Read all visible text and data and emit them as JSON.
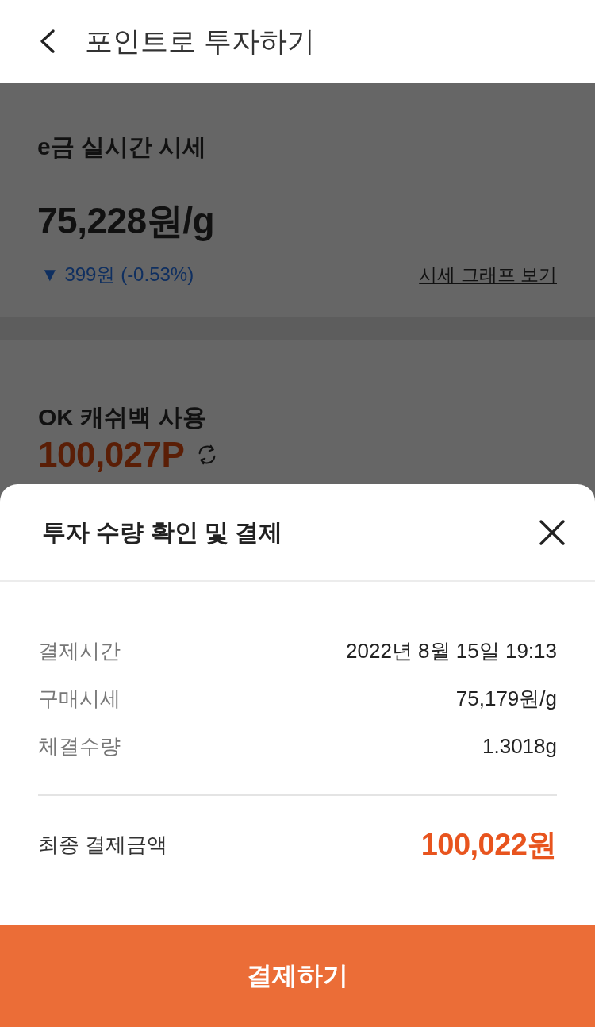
{
  "header": {
    "title": "포인트로 투자하기"
  },
  "price_card": {
    "title": "e금 실시간 시세",
    "price": "75,228원/g",
    "change": "▼ 399원 (-0.53%)",
    "graph_link": "시세 그래프 보기"
  },
  "points_card": {
    "title": "OK 캐쉬백 사용",
    "points": "100,027P"
  },
  "sheet": {
    "title": "투자 수량 확인 및 결제",
    "details": [
      {
        "label": "결제시간",
        "value": "2022년 8월 15일 19:13"
      },
      {
        "label": "구매시세",
        "value": "75,179원/g"
      },
      {
        "label": "체결수량",
        "value": "1.3018g"
      }
    ],
    "total": {
      "label": "최종 결제금액",
      "value": "100,022원"
    },
    "confirm_button": "결제하기"
  }
}
